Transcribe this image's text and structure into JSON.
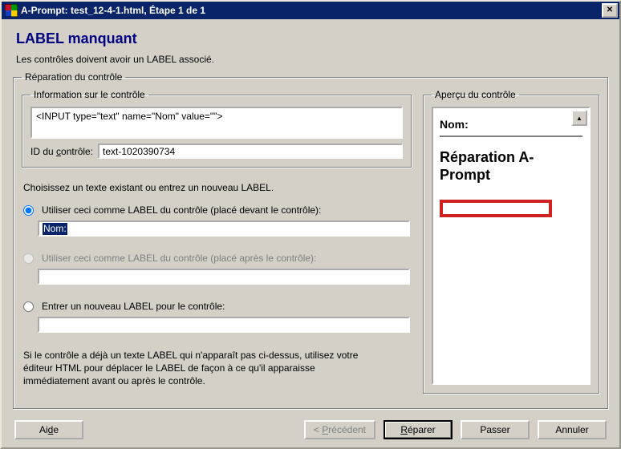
{
  "title": "A-Prompt: test_12-4-1.html, Étape 1 de 1",
  "heading": "LABEL manquant",
  "intro": "Les contrôles doivent avoir un LABEL associé.",
  "group_repair_legend": "Réparation du contrôle",
  "group_info_legend": "Information sur le contrôle",
  "control_source": "<INPUT type=\"text\" name=\"Nom\" value=\"\">",
  "control_id_label_pre": "ID du ",
  "control_id_label_u": "c",
  "control_id_label_post": "ontrôle:",
  "control_id_value": "text-1020390734",
  "chooser_instruction": "Choisissez un texte existant ou entrez un nouveau LABEL.",
  "radio_before": "Utiliser ceci comme LABEL du contrôle (placé devant le contrôle):",
  "radio_before_value": "Nom:",
  "radio_after": "Utiliser ceci comme LABEL du contrôle (placé après le contrôle):",
  "radio_after_value": "",
  "radio_new": "Entrer un nouveau LABEL pour le contrôle:",
  "radio_new_value": "",
  "note": "Si le contrôle a déjà un texte LABEL qui n'apparaît pas ci-dessus, utilisez votre éditeur HTML pour déplacer le LABEL de façon à ce qu'il apparaisse immédiatement avant ou après le contrôle.",
  "group_preview_legend": "Aperçu du contrôle",
  "preview_label": "Nom:",
  "preview_title": "Réparation A-Prompt",
  "buttons": {
    "help_pre": "Ai",
    "help_u": "d",
    "help_post": "e",
    "prev_pre": "< ",
    "prev_u": "P",
    "prev_post": "récédent",
    "repair_u": "R",
    "repair_post": "éparer",
    "skip": "Passer",
    "cancel": "Annuler"
  }
}
